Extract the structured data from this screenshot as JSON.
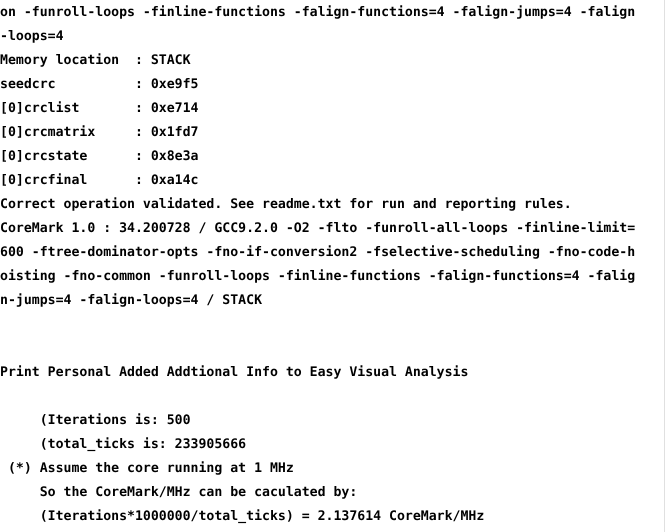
{
  "terminal": {
    "title": "CoreMark benchmark console output",
    "background_color": "#ffffff",
    "text_color": "#000000",
    "lines": [
      {
        "id": "flags-wrap-1",
        "text": "on -funroll-loops -finline-functions -falign-functions=4 -falign-jumps=4 -falign"
      },
      {
        "id": "flags-wrap-2",
        "text": "-loops=4"
      },
      {
        "id": "memory-location",
        "text": "Memory location  : STACK"
      },
      {
        "id": "seedcrc",
        "text": "seedcrc          : 0xe9f5"
      },
      {
        "id": "crclist",
        "text": "[0]crclist       : 0xe714"
      },
      {
        "id": "crcmatrix",
        "text": "[0]crcmatrix     : 0x1fd7"
      },
      {
        "id": "crcstate",
        "text": "[0]crcstate      : 0x8e3a"
      },
      {
        "id": "crcfinal",
        "text": "[0]crcfinal      : 0xa14c"
      },
      {
        "id": "validation-message",
        "text": "Correct operation validated. See readme.txt for run and reporting rules."
      },
      {
        "id": "coremark-result-wrap-1",
        "text": "CoreMark 1.0 : 34.200728 / GCC9.2.0 -O2 -flto -funroll-all-loops -finline-limit="
      },
      {
        "id": "coremark-result-wrap-2",
        "text": "600 -ftree-dominator-opts -fno-if-conversion2 -fselective-scheduling -fno-code-h"
      },
      {
        "id": "coremark-result-wrap-3",
        "text": "oisting -fno-common -funroll-loops -finline-functions -falign-functions=4 -falig"
      },
      {
        "id": "coremark-result-wrap-4",
        "text": "n-jumps=4 -falign-loops=4 / STACK"
      },
      {
        "id": "blank-1",
        "text": " "
      },
      {
        "id": "blank-2",
        "text": " "
      },
      {
        "id": "personal-info-header",
        "text": "Print Personal Added Addtional Info to Easy Visual Analysis"
      },
      {
        "id": "blank-3",
        "text": " "
      },
      {
        "id": "iterations",
        "text": "     (Iterations is: 500"
      },
      {
        "id": "total-ticks",
        "text": "     (total_ticks is: 233905666"
      },
      {
        "id": "assume-core-clock",
        "text": " (*) Assume the core running at 1 MHz"
      },
      {
        "id": "calculation-note",
        "text": "     So the CoreMark/MHz can be caculated by:"
      },
      {
        "id": "coremark-per-mhz",
        "text": "     (Iterations*1000000/total_ticks) = 2.137614 CoreMark/MHz"
      }
    ],
    "values": {
      "memory_location": "STACK",
      "seedcrc": "0xe9f5",
      "crclist": "0xe714",
      "crcmatrix": "0x1fd7",
      "crcstate": "0x8e3a",
      "crcfinal": "0xa14c",
      "coremark_version": "CoreMark 1.0",
      "coremark_score": "34.200728",
      "compiler": "GCC9.2.0",
      "iterations": "500",
      "total_ticks": "233905666",
      "assumed_clock": "1 MHz",
      "coremark_per_mhz": "2.137614"
    }
  }
}
